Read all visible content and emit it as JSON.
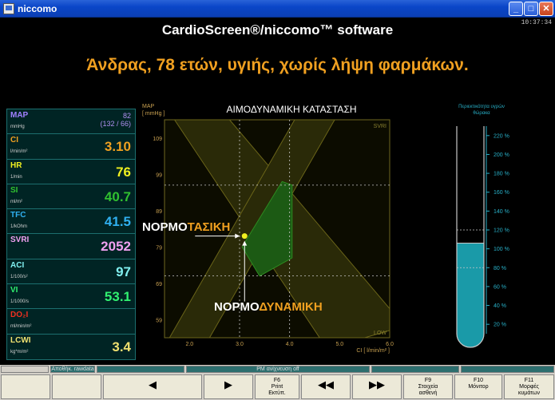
{
  "window": {
    "title": "niccomo",
    "clock": "10:37:34",
    "min": "_",
    "max": "□",
    "close": "✕"
  },
  "app": {
    "title": "CardioScreen®/niccomo™ software"
  },
  "subject": "Άνδρας, 78 ετών, υγιής, χωρίς λήψη φαρμάκων.",
  "params": [
    {
      "name": "MAP",
      "unit": "mmHg",
      "value": "",
      "extra1": "82",
      "extra2": "(132 / 66)",
      "color": "#a080ff"
    },
    {
      "name": "CI",
      "unit": "l/min/m²",
      "value": "3.10",
      "color": "#f0a020"
    },
    {
      "name": "HR",
      "unit": "1/min",
      "value": "76",
      "color": "#f0f020"
    },
    {
      "name": "SI",
      "unit": "ml/m²",
      "value": "40.7",
      "color": "#30c030"
    },
    {
      "name": "TFC",
      "unit": "1/kOhm",
      "value": "41.5",
      "color": "#30b0f0"
    },
    {
      "name": "SVRI",
      "unit": "",
      "value": "2052",
      "color": "#f0a0f0"
    },
    {
      "name": "ACI",
      "unit": "1/100/s²",
      "value": "97",
      "color": "#80f0f0"
    },
    {
      "name": "VI",
      "unit": "1/1000/s",
      "value": "53.1",
      "color": "#30f070"
    },
    {
      "name": "DO₂I",
      "unit": "ml/min/m²",
      "value": "",
      "color": "#f03020"
    },
    {
      "name": "LCWI",
      "unit": "kg*m/m²",
      "value": "3.4",
      "color": "#f0e070"
    }
  ],
  "chart_data": {
    "type": "scatter",
    "title": "ΑΙΜΟΔΥΝΑΜΙΚΗ ΚΑΤΑΣΤΑΣΗ",
    "ylabel_top": "MAP",
    "ylabel_unit": "[ mmHg ]",
    "xlabel": "CI",
    "xlabel_unit": "[ l/min/m² ]",
    "xlim": [
      1.5,
      6.0
    ],
    "ylim": [
      54,
      114
    ],
    "x_ticks": [
      "2.0",
      "3.0",
      "4.0",
      "5.0",
      "6.0"
    ],
    "y_ticks": [
      "59",
      "69",
      "79",
      "89",
      "99",
      "109"
    ],
    "region_labels": [
      "SVRI",
      "LOW"
    ],
    "point": {
      "x": 3.1,
      "y": 82
    },
    "normal_ci": [
      3.0,
      4.0
    ],
    "normal_map": [
      71,
      96
    ]
  },
  "annotations": {
    "tasiki_white": "ΝΟΡΜΟ",
    "tasiki_orange": "ΤΑΣΙΚΗ",
    "dynamiki_white": "ΝΟΡΜΟ",
    "dynamiki_orange": "ΔΥΝΑΜΙΚΗ"
  },
  "gauge": {
    "title_line1": "Περιεκτικότητα υγρών",
    "title_line2": "θώρακα",
    "ticks": [
      "220 %",
      "200 %",
      "180 %",
      "160 %",
      "140 %",
      "120 %",
      "100 %",
      "80 %",
      "60 %",
      "40 %",
      "20 %"
    ],
    "level_percent": 106,
    "normal_range": [
      80,
      120
    ],
    "color": "#28b0c8"
  },
  "statusbar": {
    "left": "Αποθήκ. rawdata",
    "middle": "PM ανίχνευση off"
  },
  "fkeys": [
    {
      "label": "",
      "sub": ""
    },
    {
      "label": "",
      "sub": ""
    },
    {
      "label": "◀",
      "sub": ""
    },
    {
      "label": "▶",
      "sub": ""
    },
    {
      "label": "F6",
      "sub": "Print",
      "sub2": "Εκτύπ."
    },
    {
      "label": "◀◀",
      "sub": ""
    },
    {
      "label": "▶▶",
      "sub": ""
    },
    {
      "label": "F9",
      "sub": "Στοιχεία",
      "sub2": "ασθενή"
    },
    {
      "label": "F10",
      "sub": "Μόνιτορ",
      "sub2": ""
    },
    {
      "label": "F11",
      "sub": "Μορφές",
      "sub2": "κυμάτων"
    }
  ]
}
